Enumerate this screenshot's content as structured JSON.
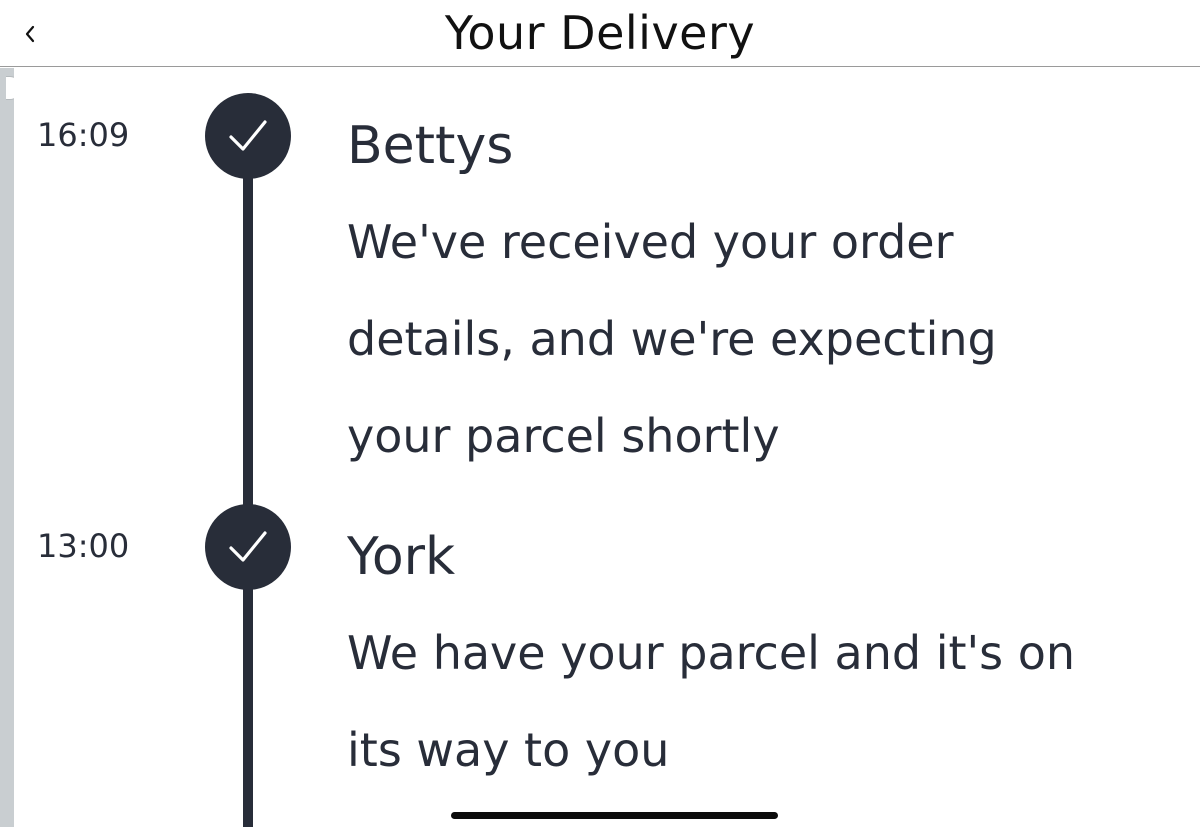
{
  "header": {
    "title": "Your Delivery",
    "back_icon": "chevron-left-icon"
  },
  "events": [
    {
      "time": "16:09",
      "location": "Bettys",
      "line1": "We've received your order",
      "line2": "details, and we're expecting",
      "line3": "your parcel shortly",
      "status_icon": "check-icon"
    },
    {
      "time": "13:00",
      "location": "York",
      "line1": "We have your parcel and it's on",
      "line2": "its way to you",
      "status_icon": "check-icon"
    }
  ],
  "colors": {
    "primary_text": "#282d39",
    "timeline": "#282d39",
    "check_mark": "#ffffff",
    "background": "#ffffff",
    "header_divider": "#9a9a9a"
  }
}
